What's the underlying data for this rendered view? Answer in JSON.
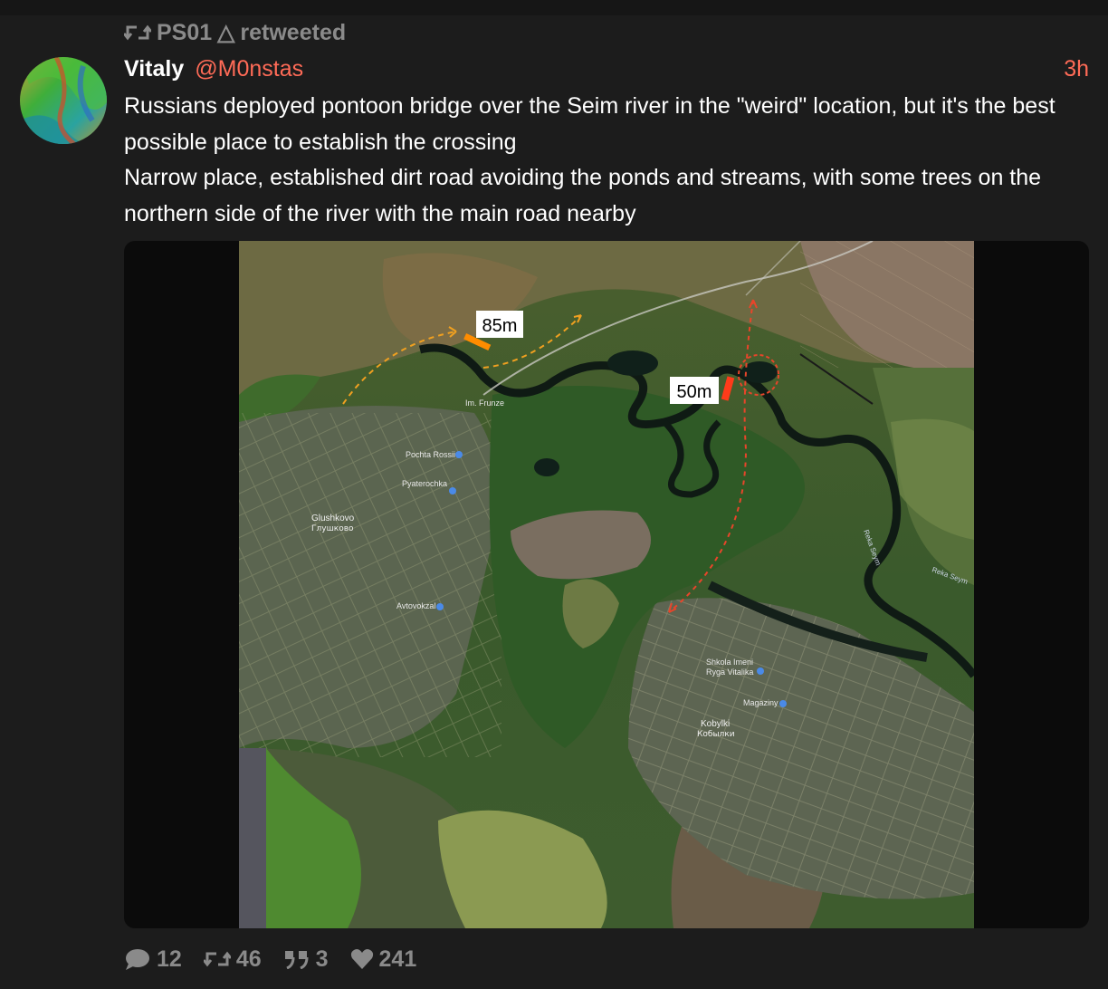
{
  "retweet_banner": {
    "user": "PS01",
    "glyph": "△",
    "text": "retweeted",
    "icon": "retweet-icon"
  },
  "tweet": {
    "author_name": "Vitaly",
    "author_handle": "@M0nstas",
    "timestamp": "3h",
    "text_lines": [
      "Russians deployed pontoon bridge over the Seim river in the \"weird\" location, but it's the best possible place to establish the crossing",
      "Narrow place, established dirt road avoiding the ponds and streams, with some trees on the northern side of the river with the main road nearby"
    ]
  },
  "map": {
    "labels": {
      "bridge_left": "85m",
      "bridge_right": "50m",
      "village_main": "Glushkovo",
      "village_main_cyr": "Глушково",
      "village_second": "Kobylki",
      "village_second_cyr": "Кобылки",
      "poi_post": "Pochta Rossii",
      "poi_shop": "Pyaterochka",
      "poi_garage": "Avtovokzal",
      "poi_school": "Shkola Imeni",
      "poi_school_2": "Ryga Vitalika",
      "poi_store": "Magaziny",
      "poi_center": "Im. Frunze",
      "river_label": "Reka Seym"
    },
    "colors": {
      "arrow_left": "#f0a020",
      "arrow_right": "#e8452a",
      "bridge_left": "#ff8c00",
      "bridge_right": "#ff3b1a"
    }
  },
  "actions": {
    "replies": "12",
    "retweets": "46",
    "quotes": "3",
    "likes": "241"
  },
  "colors": {
    "background": "#1c1c1c",
    "accent": "#ff6b57",
    "muted": "#8a8a8a"
  }
}
